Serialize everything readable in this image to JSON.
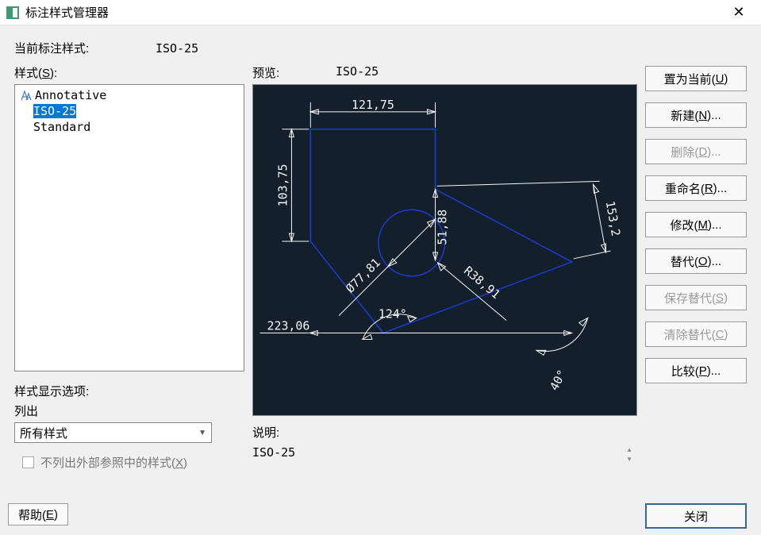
{
  "titlebar": {
    "title": "标注样式管理器"
  },
  "current": {
    "label": "当前标注样式:",
    "value": "ISO-25"
  },
  "styles": {
    "label": "样式(S):",
    "items": [
      {
        "text": "Annotative",
        "icon": true,
        "selected": false
      },
      {
        "text": "ISO-25",
        "icon": false,
        "selected": true
      },
      {
        "text": "Standard",
        "icon": false,
        "selected": false
      }
    ]
  },
  "style_display": {
    "label": "样式显示选项:",
    "list_label": "列出",
    "select_value": "所有样式",
    "checkbox_label": "不列出外部参照中的样式(X)"
  },
  "preview": {
    "label": "预览:",
    "value": "ISO-25"
  },
  "description": {
    "label": "说明:",
    "text": "ISO-25"
  },
  "buttons": {
    "set_current": "置为当前(U)",
    "new": "新建(N)...",
    "delete": "删除(D)...",
    "rename": "重命名(R)...",
    "modify": "修改(M)...",
    "override": "替代(O)...",
    "save_override": "保存替代(S)",
    "clear_override": "清除替代(C)",
    "compare": "比较(P)..."
  },
  "footer": {
    "help": "帮助(E)",
    "close": "关闭"
  },
  "dims": {
    "d1": "121,75",
    "d2": "103,75",
    "d3": "51,88",
    "d4": "153,2",
    "d5": "Ø77,81",
    "d6": "R38,91",
    "d7": "124°",
    "d8": "223,06",
    "d9": "40°"
  }
}
